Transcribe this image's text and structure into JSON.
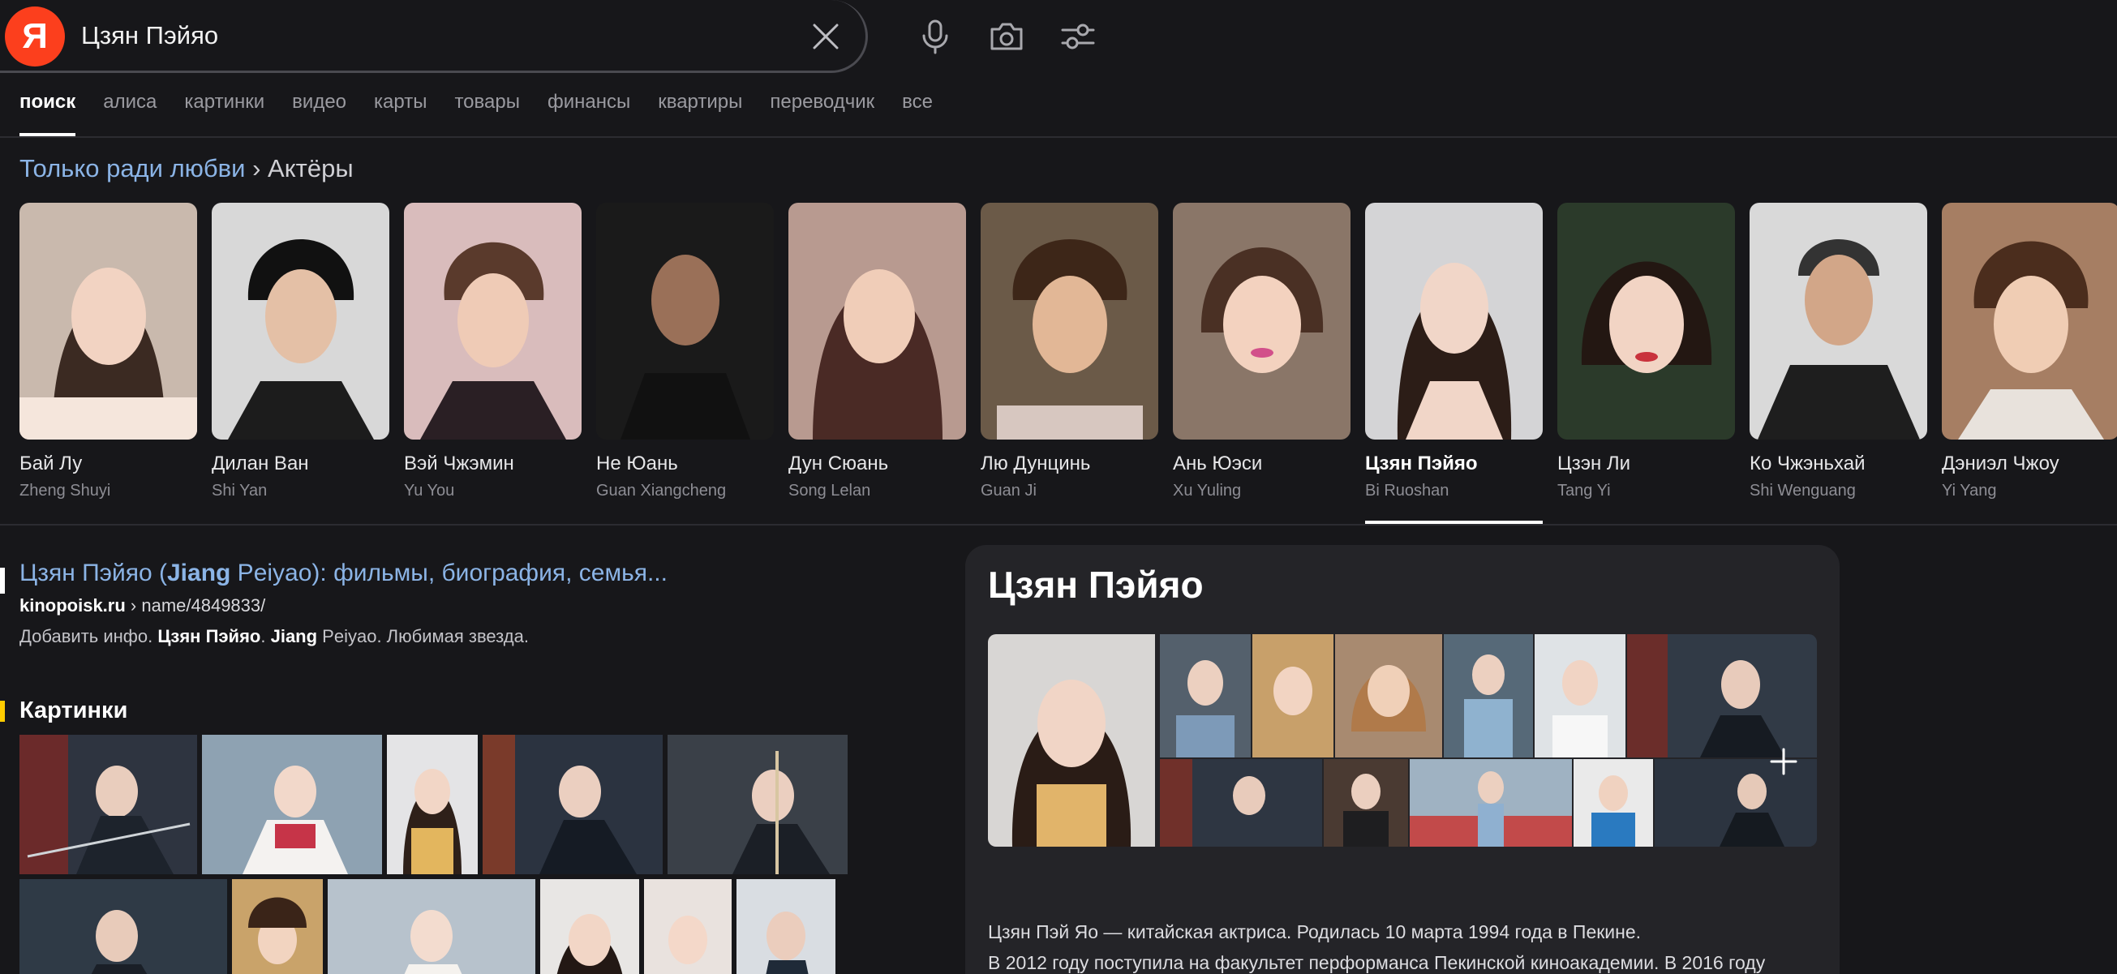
{
  "search": {
    "logo_letter": "Я",
    "query": "Цзян Пэйяо"
  },
  "tabs": [
    "поиск",
    "алиса",
    "картинки",
    "видео",
    "карты",
    "товары",
    "финансы",
    "квартиры",
    "переводчик",
    "все"
  ],
  "breadcrumb": {
    "parent": "Только ради любви",
    "separator": "›",
    "current": "Актёры"
  },
  "actors": [
    {
      "name": "Бай Лу",
      "role": "Zheng Shuyi"
    },
    {
      "name": "Дилан Ван",
      "role": "Shi Yan"
    },
    {
      "name": "Вэй Чжэмин",
      "role": "Yu You"
    },
    {
      "name": "Не Юань",
      "role": "Guan Xiangcheng"
    },
    {
      "name": "Дун Сюань",
      "role": "Song Lelan"
    },
    {
      "name": "Лю Дунцинь",
      "role": "Guan Ji"
    },
    {
      "name": "Ань Юэси",
      "role": "Xu Yuling"
    },
    {
      "name": "Цзян Пэйяо",
      "role": "Bi Ruoshan"
    },
    {
      "name": "Цзэн Ли",
      "role": "Tang Yi"
    },
    {
      "name": "Ко Чжэньхай",
      "role": "Shi Wenguang"
    },
    {
      "name": "Дэниэл Чжоу",
      "role": "Yi Yang"
    }
  ],
  "result": {
    "title_part1": "Цзян Пэйяо (",
    "title_bold": "Jiang",
    "title_part2": " Peiyao): фильмы, биография, семья...",
    "domain": "kinopoisk.ru",
    "path": " › name/4849833/",
    "snippet_part1": "Добавить инфо. ",
    "snippet_bold1": "Цзян Пэйяо",
    "snippet_part2": ". ",
    "snippet_bold2": "Jiang",
    "snippet_part3": " Peiyao. Любимая звезда."
  },
  "images_title": "Картинки",
  "card": {
    "title": "Цзян Пэйяо",
    "bio_line1": "Цзян Пэй Яо — китайская актриса. Родилась 10 марта 1994 года в Пекине.",
    "bio_line2": "В 2012 году поступила на факультет перформанса Пекинской киноакадемии. В 2016 году"
  },
  "colors": {
    "background": "#17171a",
    "link": "#8bb4e6",
    "logo": "#fc3f1d",
    "card": "#242428"
  }
}
